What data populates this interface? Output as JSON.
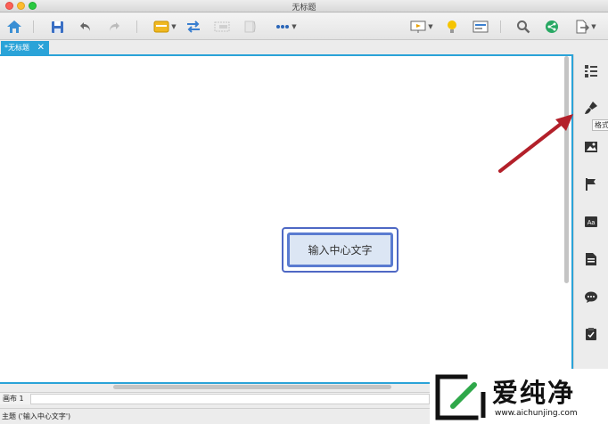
{
  "window": {
    "title": "无标题"
  },
  "toolbar": {
    "icons": [
      "home-icon",
      "save-icon",
      "undo-icon",
      "redo-icon",
      "topic-icon",
      "relationship-icon",
      "boundary-icon",
      "summary-icon",
      "more-icon",
      "presentation-icon",
      "idea-icon",
      "outline-icon",
      "search-icon",
      "share-icon",
      "export-icon"
    ]
  },
  "tabs": {
    "document": "*无标题",
    "close_glyph": "✕"
  },
  "canvas": {
    "central_topic": "输入中心文字"
  },
  "right_panel": {
    "icons": [
      "outline-list-icon",
      "format-brush-icon",
      "image-icon",
      "flag-marker-icon",
      "text-style-icon",
      "notes-icon",
      "comments-icon",
      "tasks-icon"
    ],
    "tooltip": "格式"
  },
  "sheets": {
    "sheet1": "画布 1"
  },
  "status": {
    "text": "主题 ('输入中心文字')"
  },
  "watermark": {
    "brand": "爱纯净",
    "url": "www.aichunjing.com"
  },
  "colors": {
    "accent": "#2aa3d8",
    "topic_border": "#4e68c4",
    "arrow": "#b3202a"
  }
}
